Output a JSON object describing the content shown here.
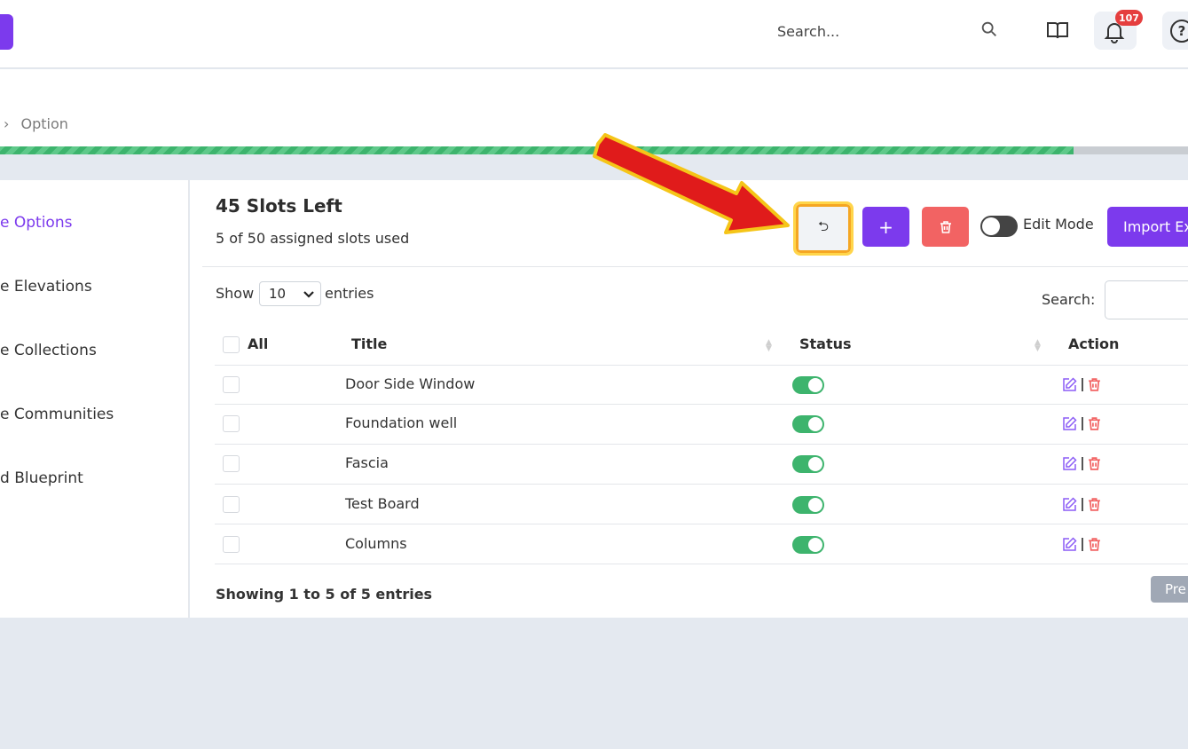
{
  "topbar": {
    "search_placeholder": "Search...",
    "notification_count": "107",
    "help_glyph": "?"
  },
  "breadcrumb": {
    "current": "Option",
    "separator": "›"
  },
  "progress": {
    "fraction": 0.904
  },
  "sidebar": {
    "items": [
      {
        "label": "e Options",
        "active": true
      },
      {
        "label": "e Elevations",
        "active": false
      },
      {
        "label": "e Collections",
        "active": false
      },
      {
        "label": "e Communities",
        "active": false
      },
      {
        "label": "d Blueprint",
        "active": false
      }
    ]
  },
  "panel": {
    "slots_title": "45 Slots Left",
    "slots_sub": "5 of 50 assigned slots used",
    "undo_glyph": "⮌",
    "add_glyph": "+",
    "edit_mode_label": "Edit Mode",
    "import_label": "Import Ex"
  },
  "table": {
    "show_label": "Show",
    "page_size": "10",
    "entries_label": "entries",
    "search_label": "Search:",
    "headers": {
      "all": "All",
      "title": "Title",
      "status": "Status",
      "action": "Action"
    },
    "rows": [
      {
        "title": "Door Side Window",
        "status": true
      },
      {
        "title": "Foundation well",
        "status": true
      },
      {
        "title": "Fascia",
        "status": true
      },
      {
        "title": "Test Board",
        "status": true
      },
      {
        "title": "Columns",
        "status": true
      }
    ],
    "showing": "Showing 1 to 5 of 5 entries",
    "prev_label": "Pre"
  },
  "colors": {
    "accent": "#7c3aed",
    "danger": "#f26363",
    "success": "#3db46d",
    "annotation_arrow": "#e01b1b",
    "annotation_highlight": "#f5a623"
  }
}
